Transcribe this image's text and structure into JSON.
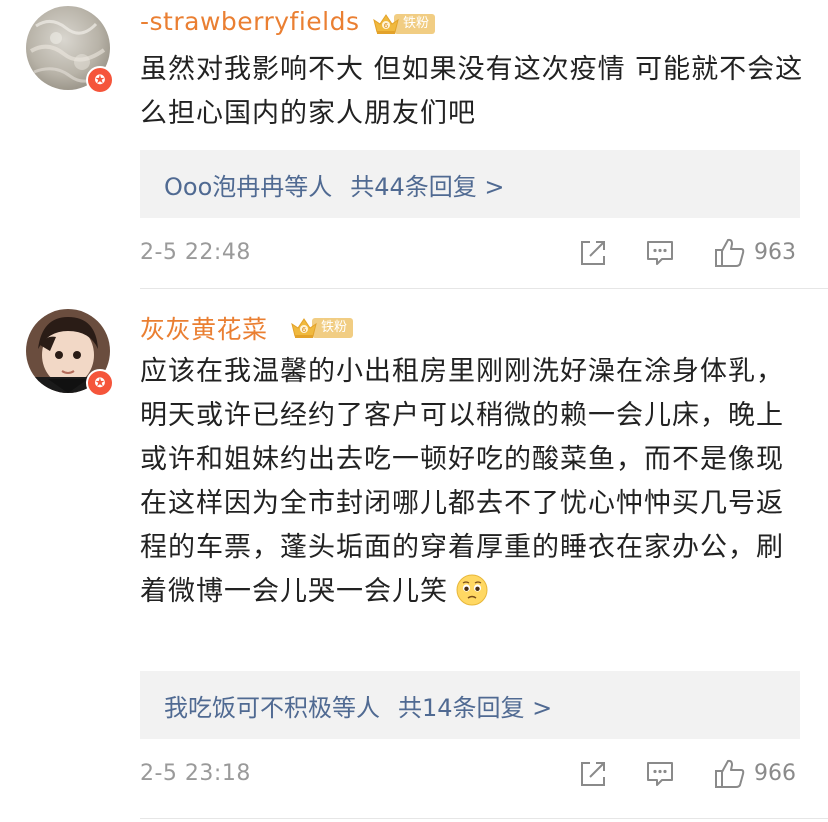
{
  "comments": [
    {
      "username": "-strawberryfields",
      "fan_badge": "铁粉",
      "text": "虽然对我影响不大 但如果没有这次疫情 可能就不会这么担心国内的家人朋友们吧",
      "replies_users": "Ooo泡冉冉等人",
      "replies_count": "共44条回复 >",
      "timestamp": "2-5 22:48",
      "likes": "963"
    },
    {
      "username": "灰灰黄花菜",
      "fan_badge": "铁粉",
      "text": "应该在我温馨的小出租房里刚刚洗好澡在涂身体乳，明天或许已经约了客户可以稍微的赖一会儿床，晚上或许和姐妹约出去吃一顿好吃的酸菜鱼，而不是像现在这样因为全市封闭哪儿都去不了忧心忡忡买几号返程的车票，蓬头垢面的穿着厚重的睡衣在家办公，刷着微博一会儿哭一会儿笑",
      "emoji": "pleading-face-emoji",
      "replies_users": "我吃饭可不积极等人",
      "replies_count": "共14条回复 >",
      "timestamp": "2-5 23:18",
      "likes": "966"
    }
  ],
  "colors": {
    "username": "#ea7f32",
    "link": "#506a92",
    "reply_box_bg": "#f2f2f2",
    "badge_red": "#f5553b",
    "fan_badge_bg": "#f1cd83",
    "meta_gray": "#9a9a9a"
  },
  "icons": [
    "share-icon",
    "comment-icon",
    "thumbs-up-icon",
    "user-badge-icon",
    "crown-icon"
  ]
}
